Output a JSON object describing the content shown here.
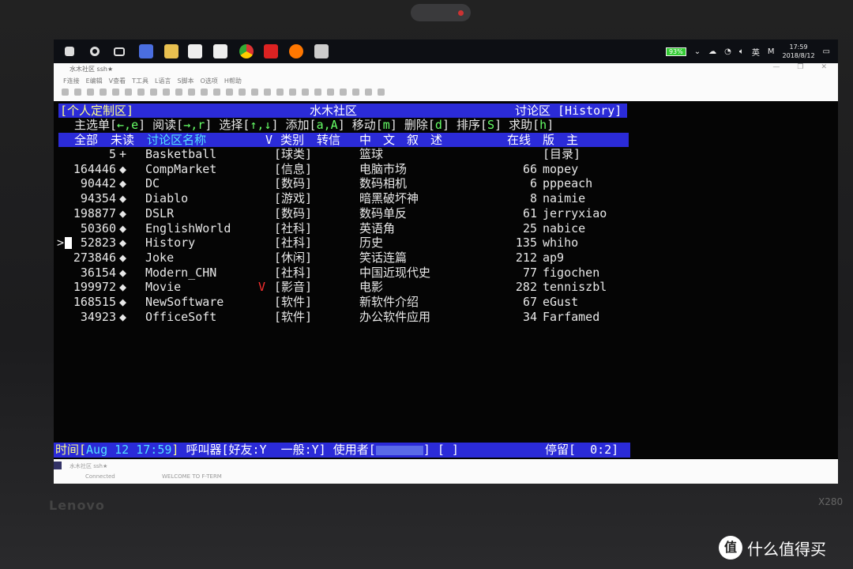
{
  "taskbar": {
    "battery": "93%",
    "ime": "英",
    "clock_time": "17:59",
    "clock_date": "2018/8/12"
  },
  "window": {
    "title": "水木社区 ssh★",
    "menu": [
      "F连接",
      "E编辑",
      "V查看",
      "T工具",
      "L语言",
      "S脚本",
      "O选项",
      "H帮助"
    ],
    "status_tab": "水木社区 ssh★",
    "status_connected": "Connected",
    "status_message": "WELCOME TO F-TERM"
  },
  "terminal": {
    "header_left": "[个人定制区]",
    "header_center": "水木社区",
    "header_right": "讨论区 [History]",
    "help": [
      {
        "label": "主选单[",
        "key": "←,e",
        "end": "]"
      },
      {
        "label": " 阅读[",
        "key": "→,r",
        "end": "]"
      },
      {
        "label": " 选择[",
        "key": "↑,↓",
        "end": "]"
      },
      {
        "label": " 添加[",
        "key": "a,A",
        "end": "]"
      },
      {
        "label": " 移动[",
        "key": "m",
        "end": "]"
      },
      {
        "label": " 删除[",
        "key": "d",
        "end": "]"
      },
      {
        "label": " 排序[",
        "key": "S",
        "end": "]"
      },
      {
        "label": " 求助[",
        "key": "h",
        "end": "]"
      }
    ],
    "columns": {
      "all": "全部",
      "unread": "未读",
      "name": "讨论区名称",
      "v": "V",
      "category": "类别",
      "forward": "转信",
      "desc": "中　文　叙　述",
      "online": "在线",
      "moderator": "版　主"
    },
    "rows": [
      {
        "count": "5",
        "mark": "+",
        "name": "Basketball",
        "v": "",
        "category": "[球类]",
        "desc": "篮球",
        "online": "",
        "moderator": "[目录]"
      },
      {
        "count": "164446",
        "mark": "◆",
        "name": "CompMarket",
        "v": "",
        "category": "[信息]",
        "desc": "电脑市场",
        "online": "66",
        "moderator": "mopey"
      },
      {
        "count": "90442",
        "mark": "◆",
        "name": "DC",
        "v": "",
        "category": "[数码]",
        "desc": "数码相机",
        "online": "6",
        "moderator": "pppeach"
      },
      {
        "count": "94354",
        "mark": "◆",
        "name": "Diablo",
        "v": "",
        "category": "[游戏]",
        "desc": "暗黑破坏神",
        "online": "8",
        "moderator": "naimie"
      },
      {
        "count": "198877",
        "mark": "◆",
        "name": "DSLR",
        "v": "",
        "category": "[数码]",
        "desc": "数码单反",
        "online": "61",
        "moderator": "jerryxiao"
      },
      {
        "count": "50360",
        "mark": "◆",
        "name": "EnglishWorld",
        "v": "",
        "category": "[社科]",
        "desc": "英语角",
        "online": "25",
        "moderator": "nabice"
      },
      {
        "count": "52823",
        "mark": "◆",
        "name": "History",
        "v": "",
        "category": "[社科]",
        "desc": "历史",
        "online": "135",
        "moderator": "whiho",
        "selected": true
      },
      {
        "count": "273846",
        "mark": "◆",
        "name": "Joke",
        "v": "",
        "category": "[休闲]",
        "desc": "笑话连篇",
        "online": "212",
        "moderator": "ap9"
      },
      {
        "count": "36154",
        "mark": "◆",
        "name": "Modern_CHN",
        "v": "",
        "category": "[社科]",
        "desc": "中国近现代史",
        "online": "77",
        "moderator": "figochen"
      },
      {
        "count": "199972",
        "mark": "◆",
        "name": "Movie",
        "v": "V",
        "category": "[影音]",
        "desc": "电影",
        "online": "282",
        "moderator": "tenniszbl"
      },
      {
        "count": "168515",
        "mark": "◆",
        "name": "NewSoftware",
        "v": "",
        "category": "[软件]",
        "desc": "新软件介绍",
        "online": "67",
        "moderator": "eGust"
      },
      {
        "count": "34923",
        "mark": "◆",
        "name": "OfficeSoft",
        "v": "",
        "category": "[软件]",
        "desc": "办公软件应用",
        "online": "34",
        "moderator": "Farfamed"
      }
    ],
    "cursor": ">",
    "status": {
      "time_label": "时间[",
      "time": "Aug 12 17:59",
      "time_end": "]",
      "pager": " 呼叫器[好友:Y  一般:Y] 使用者[",
      "user_end": "] [ ]",
      "stay": "停留[  0:2]"
    }
  },
  "device": {
    "brand": "Lenovo",
    "model": "X280"
  },
  "watermark": {
    "icon": "值",
    "text": "什么值得买"
  },
  "colors": {
    "bar": "#2b2bd8",
    "key": "#66ff66",
    "highlight": "#ffff88",
    "name_header": "#55e0ff",
    "vote": "#ff3030"
  }
}
